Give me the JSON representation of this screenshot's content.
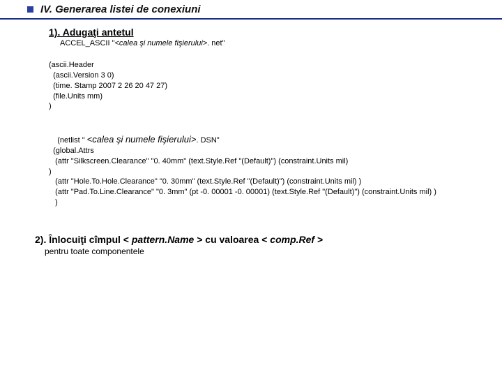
{
  "header": {
    "title": "IV. Generarea listei de conexiuni"
  },
  "step1": {
    "heading": "1).  Adugaţi antetul",
    "sub_prefix": "ACCEL_ASCII \"",
    "sub_italic": "<calea şi numele fişierului>",
    "sub_suffix": ". net\""
  },
  "codeblock1": "(ascii.Header\n  (ascii.Version 3 0)\n  (time. Stamp 2007 2 26 20 47 27)\n  (file.Units mm)\n)",
  "netlist": {
    "prefix": "(netlist \" ",
    "placeholder": "<calea şi numele fişierului>",
    "suffix": ". DSN\""
  },
  "codeblock2": "  (global.Attrs\n   (attr \"Silkscreen.Clearance\" \"0. 40mm\" (text.Style.Ref \"(Default)\") (constraint.Units mil)\n)\n   (attr \"Hole.To.Hole.Clearance\" \"0. 30mm\" (text.Style.Ref \"(Default)\") (constraint.Units mil) )\n   (attr \"Pad.To.Line.Clearance\" \"0. 3mm\" (pt -0. 00001 -0. 00001) (text.Style.Ref \"(Default)\") (constraint.Units mil) )\n   )",
  "step2": {
    "lead": "2).  Înlocuiţi cîmpul < ",
    "italic1": "pattern.Name",
    "mid": " > cu valoarea < ",
    "italic2": "comp.Ref",
    "tail": " >",
    "sub": "pentru toate componentele"
  }
}
